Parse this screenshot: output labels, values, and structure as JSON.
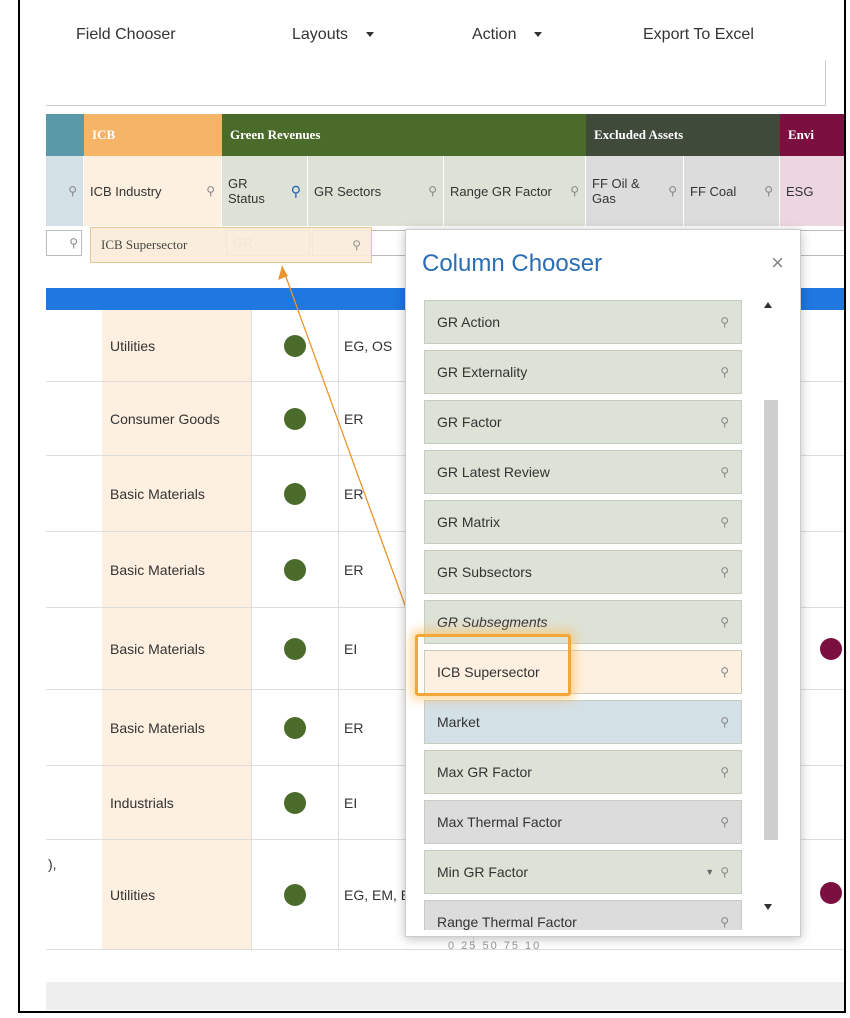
{
  "toolbar": {
    "field_chooser": "Field Chooser",
    "layouts": "Layouts",
    "action": "Action",
    "export": "Export To Excel"
  },
  "groups": {
    "icb": "ICB",
    "green_revenues": "Green Revenues",
    "excluded_assets": "Excluded Assets",
    "env": "Envi"
  },
  "columns": {
    "icb_industry": "ICB Industry",
    "gr_status": "GR Status",
    "gr_sectors": "GR Sectors",
    "range_gr_factor": "Range GR Factor",
    "ff_oil_gas": "FF Oil & Gas",
    "ff_coal": "FF Coal",
    "esg": "ESG"
  },
  "filter": {
    "gr_placeholder": "GR"
  },
  "drag_ghost": {
    "label": "ICB Supersector"
  },
  "rows": [
    {
      "industry": "Utilities",
      "sectors": "EG, OS"
    },
    {
      "industry": "Consumer Goods",
      "sectors": "ER"
    },
    {
      "industry": "Basic Materials",
      "sectors": "ER"
    },
    {
      "industry": "Basic Materials",
      "sectors": "ER"
    },
    {
      "industry": "Basic Materials",
      "sectors": "EI"
    },
    {
      "industry": "Basic Materials",
      "sectors": "ER"
    },
    {
      "industry": "Industrials",
      "sectors": "EI"
    },
    {
      "industry": "Utilities",
      "sectors": "EG, EM, EQ,"
    }
  ],
  "row_fragment": "),",
  "range_under": "0 25 50 75 10",
  "column_chooser": {
    "title": "Column Chooser",
    "close": "×",
    "items": [
      {
        "label": "GR Action",
        "bg": "#dde2d6"
      },
      {
        "label": "GR Externality",
        "bg": "#dde2d6"
      },
      {
        "label": "GR Factor",
        "bg": "#dde2d6"
      },
      {
        "label": "GR Latest Review",
        "bg": "#dde2d6"
      },
      {
        "label": "GR Matrix",
        "bg": "#dde2d6"
      },
      {
        "label": "GR Subsectors",
        "bg": "#dde2d6"
      },
      {
        "label": "GR Subsegments",
        "bg": "#dde2d6"
      },
      {
        "label": "ICB Supersector",
        "bg": "#fdf0e0"
      },
      {
        "label": "Market",
        "bg": "#d3e0e6"
      },
      {
        "label": "Max GR Factor",
        "bg": "#dde2d6"
      },
      {
        "label": "Max Thermal Factor",
        "bg": "#dcdcdc"
      },
      {
        "label": "Min GR Factor",
        "bg": "#dde2d6"
      },
      {
        "label": "Range Thermal Factor",
        "bg": "#dcdcdc"
      }
    ]
  },
  "colors": {
    "icb": "#f5b466",
    "green_revenues": "#4b6b2a",
    "excluded_assets": "#3f4a3a",
    "env": "#7b1040",
    "market": "#5a9aa8",
    "accent_blue": "#1f77e0"
  }
}
